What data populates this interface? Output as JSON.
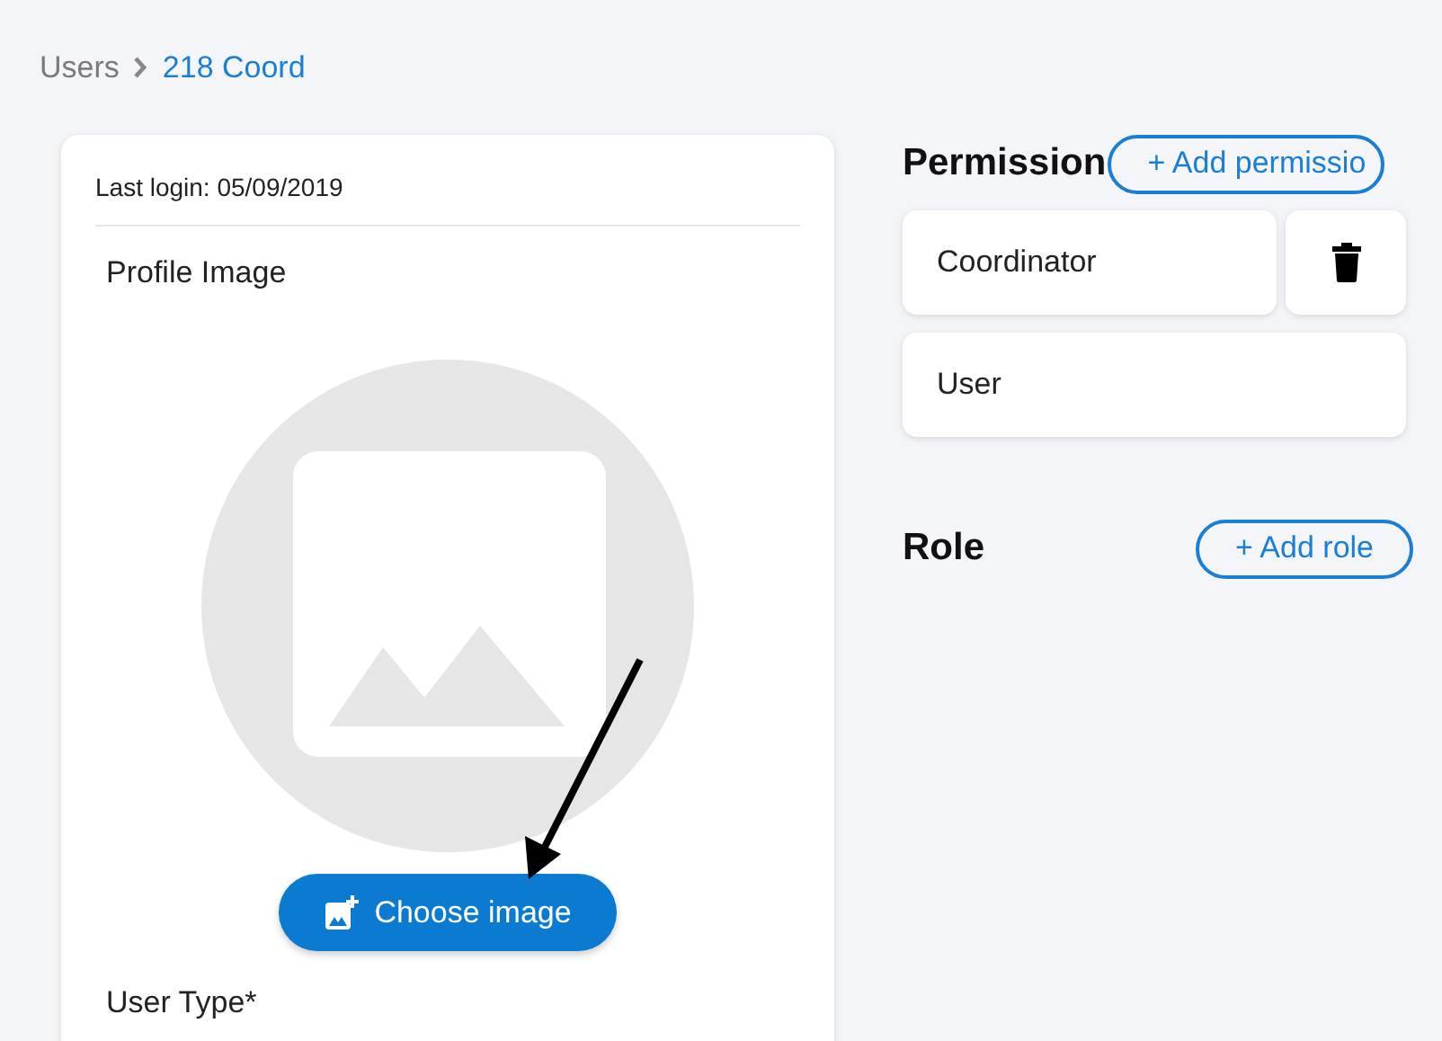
{
  "breadcrumb": {
    "parent": "Users",
    "current": "218 Coord"
  },
  "profile_card": {
    "last_login": "Last login: 05/09/2019",
    "profile_image_label": "Profile Image",
    "choose_button": "Choose image",
    "user_type_label": "User Type*"
  },
  "permission": {
    "title": "Permission",
    "add_button": "+ Add permissio",
    "items": [
      {
        "label": "Coordinator",
        "deletable": true
      },
      {
        "label": "User",
        "deletable": false
      }
    ]
  },
  "role": {
    "title": "Role",
    "add_button": "+ Add role"
  }
}
